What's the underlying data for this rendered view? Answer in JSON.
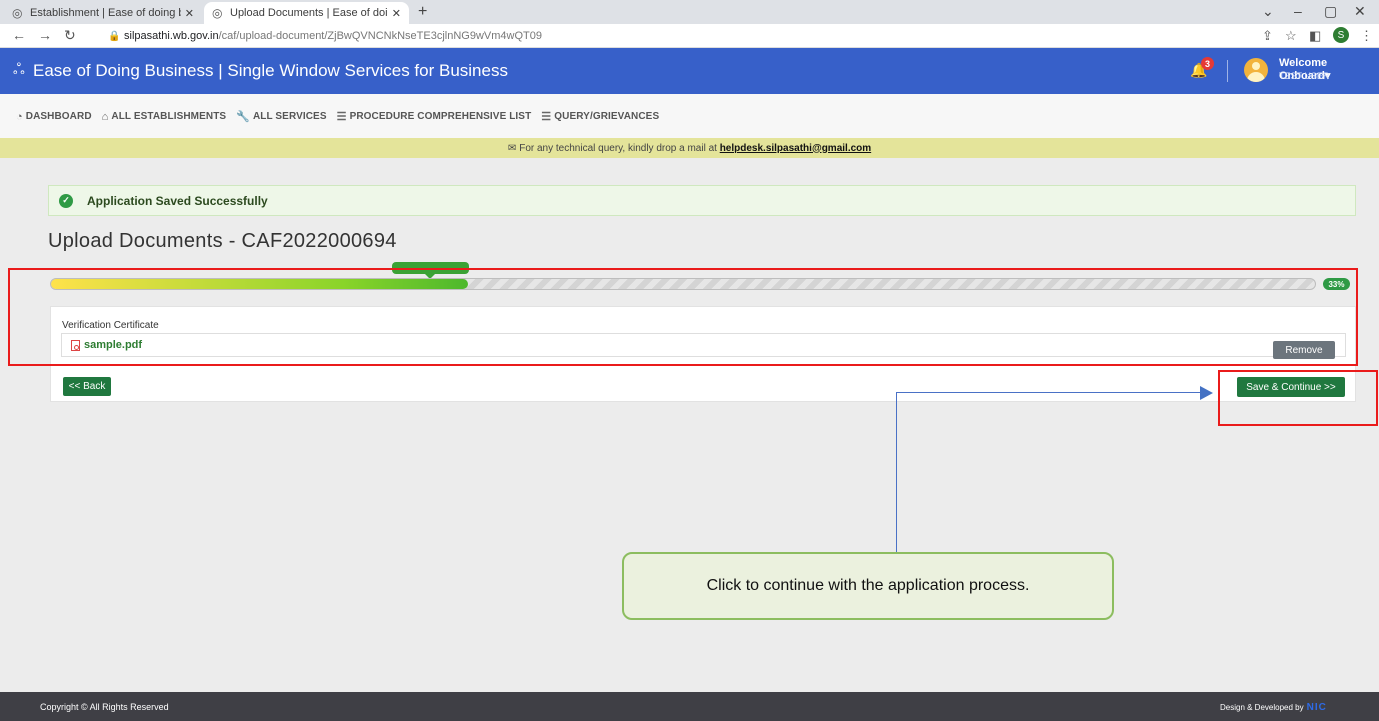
{
  "browser": {
    "tabs": [
      {
        "title": "Establishment | Ease of doing bu",
        "active": false
      },
      {
        "title": "Upload Documents | Ease of doi",
        "active": true
      }
    ],
    "url_host": "silpasathi.wb.gov.in",
    "url_path": "/caf/upload-document/ZjBwQVNCNkNseTE3cjlnNG9wVm4wQT09",
    "profile_initial": "S"
  },
  "header": {
    "title": "Ease of Doing Business | Single Window Services for Business",
    "notification_count": "3",
    "welcome": "Welcome Onboard",
    "user": "TEST USER"
  },
  "menu": [
    {
      "label": "DASHBOARD",
      "icon": "gauge-icon"
    },
    {
      "label": "ALL ESTABLISHMENTS",
      "icon": "building-icon"
    },
    {
      "label": "ALL SERVICES",
      "icon": "wrench-icon"
    },
    {
      "label": "PROCEDURE COMPREHENSIVE LIST",
      "icon": "list-icon"
    },
    {
      "label": "QUERY/GRIEVANCES",
      "icon": "list-icon"
    }
  ],
  "notice": {
    "text": "For any technical query, kindly drop a mail at",
    "email": "helpdesk.silpasathi@gmail.com"
  },
  "alert": {
    "text": "Application Saved Successfully"
  },
  "page": {
    "title": "Upload Documents - CAF2022000694"
  },
  "progress": {
    "percent": 33,
    "label": "33%"
  },
  "document": {
    "label": "Verification Certificate",
    "file": "sample.pdf",
    "remove_label": "Remove"
  },
  "actions": {
    "back_label": "<< Back",
    "save_label": "Save & Continue >>"
  },
  "annotation": {
    "callout_text": "Click to continue with the application process."
  },
  "footer": {
    "copyright": "Copyright © All Rights Reserved",
    "designed_by": "Design & Developed by",
    "developer_logo": "NIC"
  },
  "colors": {
    "header_bg": "#3760c9",
    "primary_button": "#20783f",
    "annotation_red": "#ea1b1b",
    "callout_bg": "#ebf1de"
  }
}
